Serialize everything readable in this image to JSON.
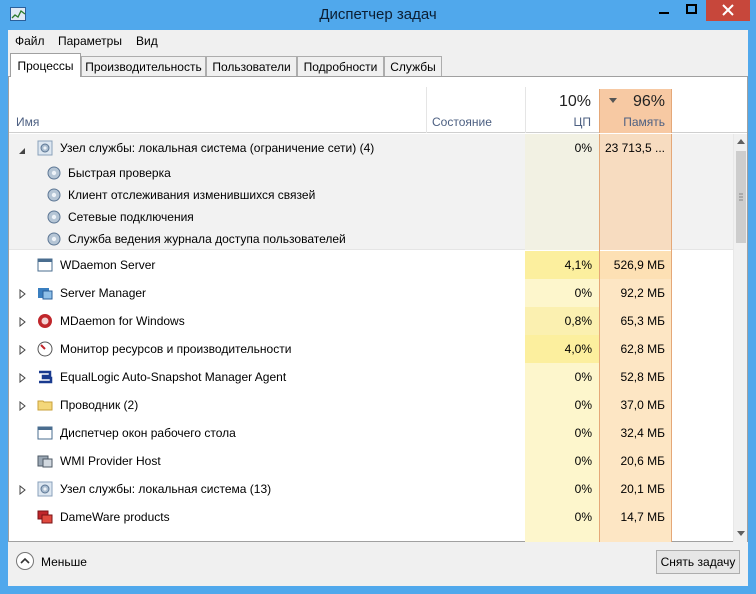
{
  "window": {
    "title": "Диспетчер задач",
    "close_color": "#c7473b",
    "titlebar_color": "#50a8ec"
  },
  "menu": [
    "Файл",
    "Параметры",
    "Вид"
  ],
  "tabs": [
    "Процессы",
    "Производительность",
    "Пользователи",
    "Подробности",
    "Службы"
  ],
  "active_tab": "Процессы",
  "columns": {
    "name": "Имя",
    "status": "Состояние",
    "cpu_total": "10%",
    "cpu": "ЦП",
    "mem_total": "96%",
    "mem": "Память"
  },
  "sort": {
    "column": "mem",
    "indicator": "chevron-down-icon"
  },
  "processes": [
    {
      "name": "Узел службы: локальная система (ограничение сети) (4)",
      "icon": "gear-icon",
      "expanded": true,
      "cpu": "0%",
      "mem": "23 713,5 ...",
      "children": [
        {
          "name": "Быстрая проверка",
          "icon": "gear-icon"
        },
        {
          "name": "Клиент отслеживания изменившихся связей",
          "icon": "gear-icon"
        },
        {
          "name": "Сетевые подключения",
          "icon": "gear-icon"
        },
        {
          "name": "Служба ведения журнала доступа пользователей",
          "icon": "gear-icon"
        }
      ]
    },
    {
      "name": "WDaemon Server",
      "icon": "window-icon",
      "expandable": false,
      "cpu": "4,1%",
      "mem": "526,9 МБ"
    },
    {
      "name": "Server Manager",
      "icon": "server-manager-icon",
      "expandable": true,
      "cpu": "0%",
      "mem": "92,2 МБ"
    },
    {
      "name": "MDaemon for Windows",
      "icon": "mdaemon-icon",
      "expandable": true,
      "cpu": "0,8%",
      "mem": "65,3 МБ"
    },
    {
      "name": "Монитор ресурсов и производительности",
      "icon": "monitor-gauge-icon",
      "expandable": true,
      "cpu": "4,0%",
      "mem": "62,8 МБ"
    },
    {
      "name": "EqualLogic Auto-Snapshot Manager Agent",
      "icon": "equallogic-icon",
      "expandable": true,
      "cpu": "0%",
      "mem": "52,8 МБ"
    },
    {
      "name": "Проводник (2)",
      "icon": "folder-icon",
      "expandable": true,
      "cpu": "0%",
      "mem": "37,0 МБ"
    },
    {
      "name": "Диспетчер окон рабочего стола",
      "icon": "window-icon",
      "expandable": false,
      "cpu": "0%",
      "mem": "32,4 МБ"
    },
    {
      "name": "WMI Provider Host",
      "icon": "wmi-icon",
      "expandable": false,
      "cpu": "0%",
      "mem": "20,6 МБ"
    },
    {
      "name": "Узел службы: локальная система (13)",
      "icon": "gear-icon",
      "expandable": true,
      "cpu": "0%",
      "mem": "20,1 МБ"
    },
    {
      "name": "DameWare products",
      "icon": "dameware-icon",
      "expandable": false,
      "cpu": "0%",
      "mem": "14,7 МБ"
    }
  ],
  "footer": {
    "less_label": "Меньше",
    "end_task": "Снять задачу"
  }
}
